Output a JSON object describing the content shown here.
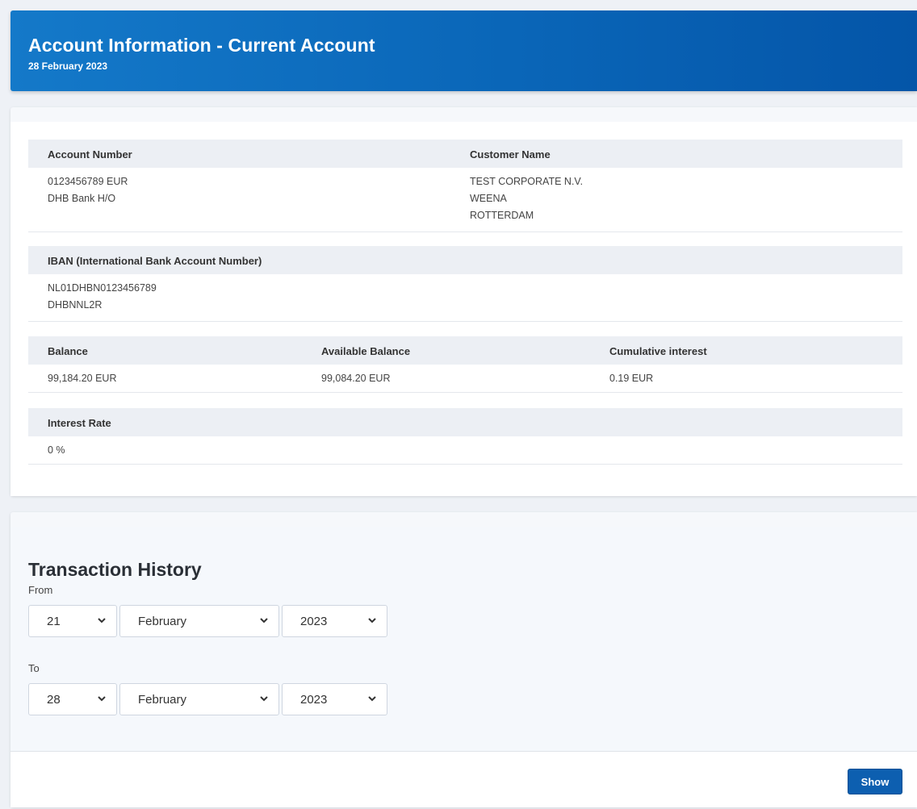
{
  "header": {
    "title": "Account Information - Current Account",
    "date": "28 February 2023"
  },
  "account": {
    "account_number_label": "Account Number",
    "account_number": "0123456789 EUR",
    "branch": "DHB Bank H/O",
    "customer_name_label": "Customer Name",
    "customer_name_lines": [
      "TEST CORPORATE N.V.",
      "WEENA",
      "ROTTERDAM"
    ],
    "iban_label": "IBAN (International Bank Account Number)",
    "iban": "NL01DHBN0123456789",
    "bic": "DHBNNL2R",
    "balance_label": "Balance",
    "balance": "99,184.20 EUR",
    "available_balance_label": "Available Balance",
    "available_balance": "99,084.20 EUR",
    "cumulative_interest_label": "Cumulative interest",
    "cumulative_interest": "0.19 EUR",
    "interest_rate_label": "Interest Rate",
    "interest_rate": "0 %"
  },
  "transactions": {
    "title": "Transaction History",
    "from_label": "From",
    "from": {
      "day": "21",
      "month": "February",
      "year": "2023"
    },
    "to_label": "To",
    "to": {
      "day": "28",
      "month": "February",
      "year": "2023"
    },
    "show_label": "Show"
  },
  "colors": {
    "header_gradient_start": "#1479c9",
    "header_gradient_end": "#0455a8",
    "button": "#0d5fb0"
  },
  "icons": {
    "dropdown": "chevron-down-icon"
  }
}
